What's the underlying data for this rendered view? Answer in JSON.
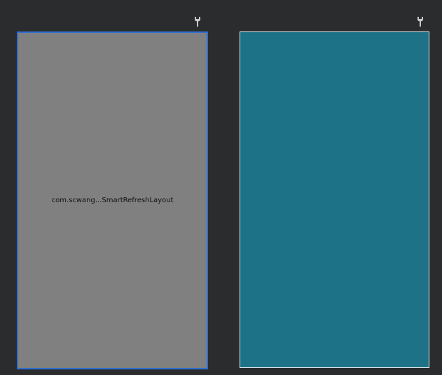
{
  "design_view": {
    "component_label": "com.scwang...SmartRefreshLayout",
    "background_color": "#808080",
    "selection_color": "#2f6fd0"
  },
  "blueprint_view": {
    "background_color": "#1e7288",
    "border_color": "#e8ecef"
  },
  "icons": {
    "design_toggle": "wrench-icon",
    "blueprint_toggle": "wrench-icon"
  },
  "colors": {
    "editor_background": "#2b2c2e",
    "icon_color": "#c8c8c8"
  }
}
